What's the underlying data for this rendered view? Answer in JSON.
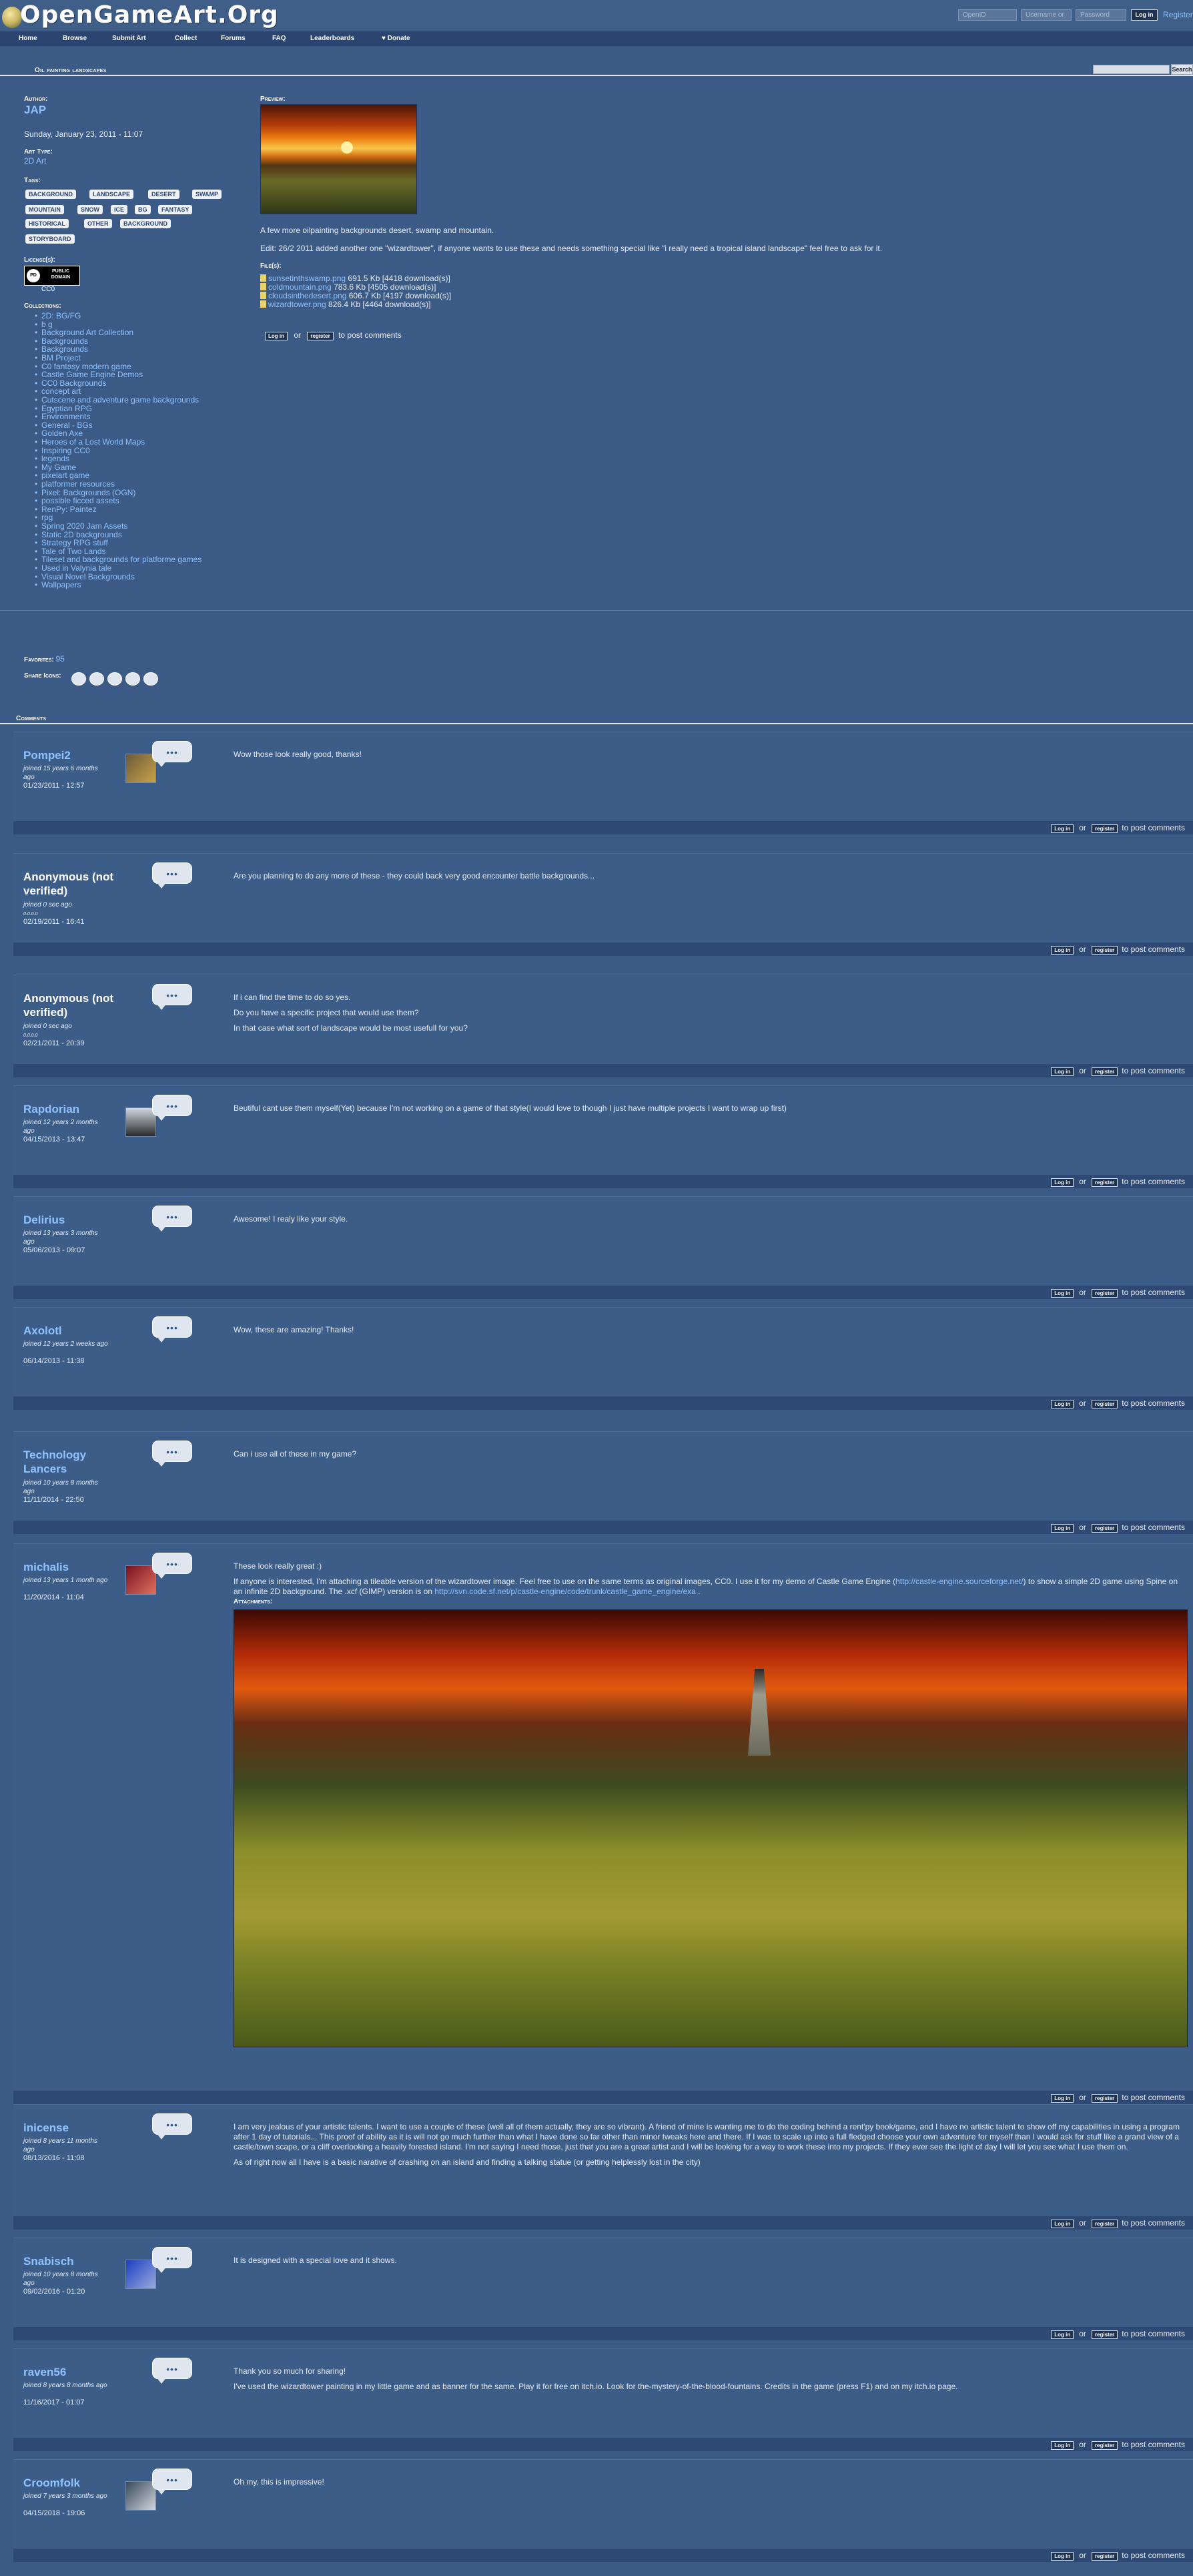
{
  "header": {
    "site_name": "OpenGameArt.Org",
    "openid_placeholder": "OpenID",
    "username_placeholder": "Username or",
    "password_placeholder": "Password",
    "login_label": "Log in",
    "register_label": "Register"
  },
  "nav": {
    "items": [
      "Home",
      "Browse",
      "Submit Art",
      "Collect",
      "Forums",
      "FAQ",
      "Leaderboards",
      "♥ Donate"
    ],
    "search_label": "Search"
  },
  "page": {
    "title": "Oil painting landscapes"
  },
  "meta": {
    "author_label": "Author:",
    "author": "JAP",
    "date": "Sunday, January 23, 2011 - 11:07",
    "art_type_label": "Art Type:",
    "art_type": "2D Art",
    "tags_label": "Tags:",
    "tags": [
      "Background",
      "Landscape",
      "Desert",
      "Swamp",
      "Mountain",
      "Snow",
      "Ice",
      "BG",
      "Fantasy",
      "Historical",
      "Other",
      "Background",
      "Storyboard"
    ],
    "license_label": "License(s):",
    "license_badge": "PUBLIC DOMAIN",
    "license_sub": "CC0",
    "collections_label": "Collections:",
    "collections": [
      "2D: BG/FG",
      "b g",
      "Background Art Collection",
      "Backgrounds",
      "Backgrounds",
      "BM Project",
      "C0 fantasy modern game",
      "Castle Game Engine Demos",
      "CC0 Backgrounds",
      "concept art",
      "Cutscene and adventure game backgrounds",
      "Egyptian RPG",
      "Environments",
      "General - BGs",
      "Golden Axe",
      "Heroes of a Lost World Maps",
      "Inspiring CC0",
      "legends",
      "My Game",
      "pixelart game",
      "platformer resources",
      "Pixel: Backgrounds (OGN)",
      "possible ficced assets",
      "RenPy: Paintez",
      "rpg",
      "Spring 2020 Jam Assets",
      "Static 2D backgrounds",
      "Strategy RPG stuff",
      "Tale of Two Lands",
      "Tileset and backgrounds for platforme games",
      "Used in Valynia tale",
      "Visual Novel Backgrounds",
      "Wallpapers"
    ],
    "favorites_label": "Favorites:",
    "favorites": "95",
    "share_label": "Share Icons:"
  },
  "content": {
    "preview_label": "Preview:",
    "desc1": "A few more oilpainting backgrounds desert, swamp and mountain.",
    "desc2": "Edit: 26/2 2011 added another one \"wizardtower\", if anyone wants to use these and needs something special like \"i really need a tropical island landscape\" feel free to ask for it.",
    "files_label": "File(s):",
    "files": [
      {
        "name": "sunsetinthswamp.png",
        "info": " 691.5 Kb [4418 download(s)]"
      },
      {
        "name": "coldmountain.png",
        "info": " 783.6 Kb [4505 download(s)]"
      },
      {
        "name": "cloudsinthedesert.png",
        "info": " 606.7 Kb [4197 download(s)]"
      },
      {
        "name": "wizardtower.png",
        "info": " 826.4 Kb [4464 download(s)]"
      }
    ],
    "login_btn": "Log in",
    "or": "or",
    "register_btn": "register",
    "to_post": "to post comments"
  },
  "comments_title": "Comments",
  "comment_actions": {
    "login": "Log in",
    "or": "or",
    "register": "register",
    "post": "to post comments"
  },
  "comments": [
    {
      "user": "Pompei2",
      "joined": "joined 15 years 6 months ago",
      "date": "01/23/2011 - 12:57",
      "body": [
        "Wow those look really good, thanks!"
      ]
    },
    {
      "user": "Anonymous (not verified)",
      "joined": "joined 0 sec ago",
      "ip": "0.0.0.0",
      "date": "02/19/2011 - 16:41",
      "body": [
        "Are you planning to do any more of these - they could back very good encounter battle backgrounds..."
      ]
    },
    {
      "user": "Anonymous (not verified)",
      "joined": "joined 0 sec ago",
      "ip": "0.0.0.0",
      "date": "02/21/2011 - 20:39",
      "body": [
        "If i can find the time to do so yes.",
        "Do you have a specific project that would use them?",
        "In that case what sort of landscape would be most usefull for you?"
      ]
    },
    {
      "user": "Rapdorian",
      "joined": "joined 12 years 2 months ago",
      "date": "04/15/2013 - 13:47",
      "body": [
        "Beutiful cant use them myself(Yet) because I'm not working on a game of that style(I would love to though I just have multiple projects I want to wrap up first)"
      ]
    },
    {
      "user": "Delirius",
      "joined": "joined 13 years 3 months ago",
      "date": "05/06/2013 - 09:07",
      "body": [
        "Awesome! I realy like your style."
      ]
    },
    {
      "user": "Axolotl",
      "joined": "joined 12 years 2 weeks ago",
      "date": "06/14/2013 - 11:38",
      "body": [
        "Wow, these are amazing! Thanks!"
      ]
    },
    {
      "user": "Technology Lancers",
      "joined": "joined 10 years 8 months ago",
      "date": "11/11/2014 - 22:50",
      "body": [
        "Can i use all of these in my game?"
      ]
    },
    {
      "user": "michalis",
      "joined": "joined 13 years 1 month ago",
      "date": "11/20/2014 - 11:04",
      "body": [
        "These look really great :)"
      ],
      "body2": "If anyone is interested, I'm attaching a tileable version of the wizardtower image. Feel free to use on the same terms as original images, CC0. I use it for my demo of Castle Game Engine (",
      "link1": "http://castle-engine.sourceforge.net/",
      "body3": ") to show a simple 2D game using Spine on an infinite 2D background. The .xcf (GIMP) version is on ",
      "link2": "http://svn.code.sf.net/p/castle-engine/code/trunk/castle_game_engine/exa",
      "body4": " .",
      "attach_label": "Attachments:"
    },
    {
      "user": "inicense",
      "joined": "joined 8 years 11 months ago",
      "date": "08/13/2016 - 11:08",
      "body": [
        "I am very jealous of your artistic talents. I want to use a couple of these (well all of them actually, they are so vibrant). A friend of mine is wanting me to do the coding behind a rent'py book/game, and I have no artistic talent to show off my capabilities in using a program after 1 day of tutorials... This proof of ability as it is will not go much further than what I have done so far other than minor tweaks here and there. If I was to scale up into a full fledged choose your own adventure for myself than I would ask for stuff like a grand view of a castle/town scape, or a cliff overlooking a heavily forested island. I'm not saying I need those, just that you are a great artist and I will be looking for a way to work these into my projects. If they ever see the light of day I will let you see what I use them on.",
        "As of right now all I have is a basic narative of crashing on an island and finding a talking statue (or getting helplessly lost in the city)"
      ]
    },
    {
      "user": "Snabisch",
      "joined": "joined 10 years 8 months ago",
      "date": "09/02/2016 - 01:20",
      "body": [
        "It is designed with a special love and it shows."
      ]
    },
    {
      "user": "raven56",
      "joined": "joined 8 years 8 months ago",
      "date": "11/16/2017 - 01:07",
      "body": [
        "Thank you so much for sharing!",
        "I've used the wizardtower painting in my little game and as banner for the same. Play it for free on itch.io. Look for the-mystery-of-the-blood-fountains. Credits in the game (press F1) and on my itch.io page."
      ]
    },
    {
      "user": "Croomfolk",
      "joined": "joined 7 years 3 months ago",
      "date": "04/15/2018 - 19:06",
      "body": [
        "Oh my, this is impressive!"
      ]
    }
  ]
}
